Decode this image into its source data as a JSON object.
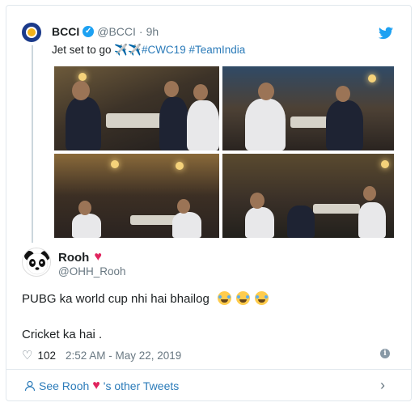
{
  "quoted_tweet": {
    "name": "BCCI",
    "handle": "@BCCI",
    "separator": "·",
    "time": "9h",
    "text_prefix": "Jet set to go",
    "text_emoji": "✈️✈️",
    "hashtags": "#CWC19 #TeamIndia",
    "photo_count": 4
  },
  "tweet": {
    "name": "Rooh",
    "name_emoji": "♥",
    "handle": "@OHH_Rooh",
    "body_line1": "PUBG ka world cup nhi hai bhailog",
    "body_line2": "Cricket ka hai .",
    "like_count": "102",
    "timestamp": "2:52 AM - May 22, 2019"
  },
  "footer": {
    "link_prefix": "See Rooh",
    "link_suffix": "'s other Tweets"
  },
  "colors": {
    "link": "#2b7bb9",
    "twitter_blue": "#1da1f2",
    "heart": "#e0245e",
    "muted": "#697882"
  },
  "icons": [
    "bcci-avatar-icon",
    "verified-icon",
    "twitter-bird-icon",
    "heart-icon",
    "like-icon",
    "info-icon",
    "user-icon",
    "chevron-right-icon",
    "panda-avatar-icon"
  ]
}
